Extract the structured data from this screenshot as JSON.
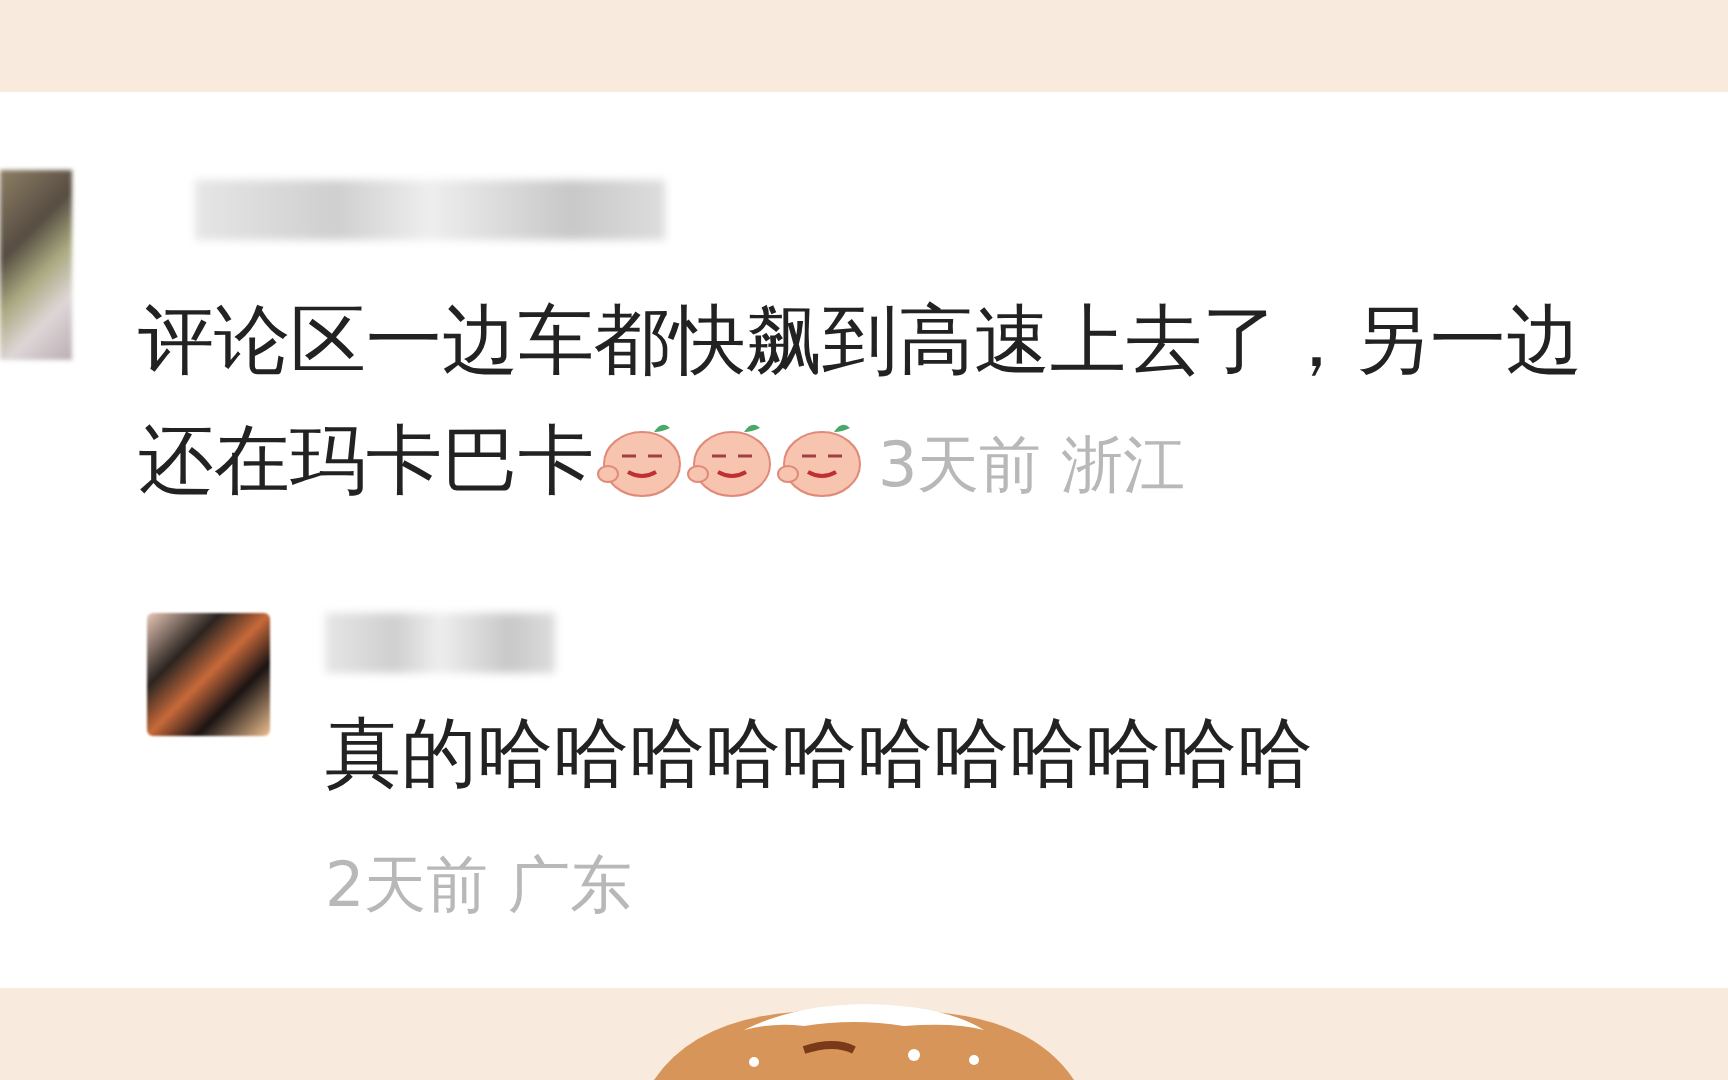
{
  "comments": [
    {
      "text": "评论区一边车都快飙到高速上去了，另一边还在玛卡巴卡",
      "emojis": [
        {
          "kind": "blush-face"
        },
        {
          "kind": "blush-face"
        },
        {
          "kind": "blush-face"
        }
      ],
      "time": "3天前",
      "location": "浙江",
      "replies": [
        {
          "text": "真的哈哈哈哈哈哈哈哈哈哈哈",
          "time": "2天前",
          "location": "广东"
        }
      ]
    }
  ]
}
